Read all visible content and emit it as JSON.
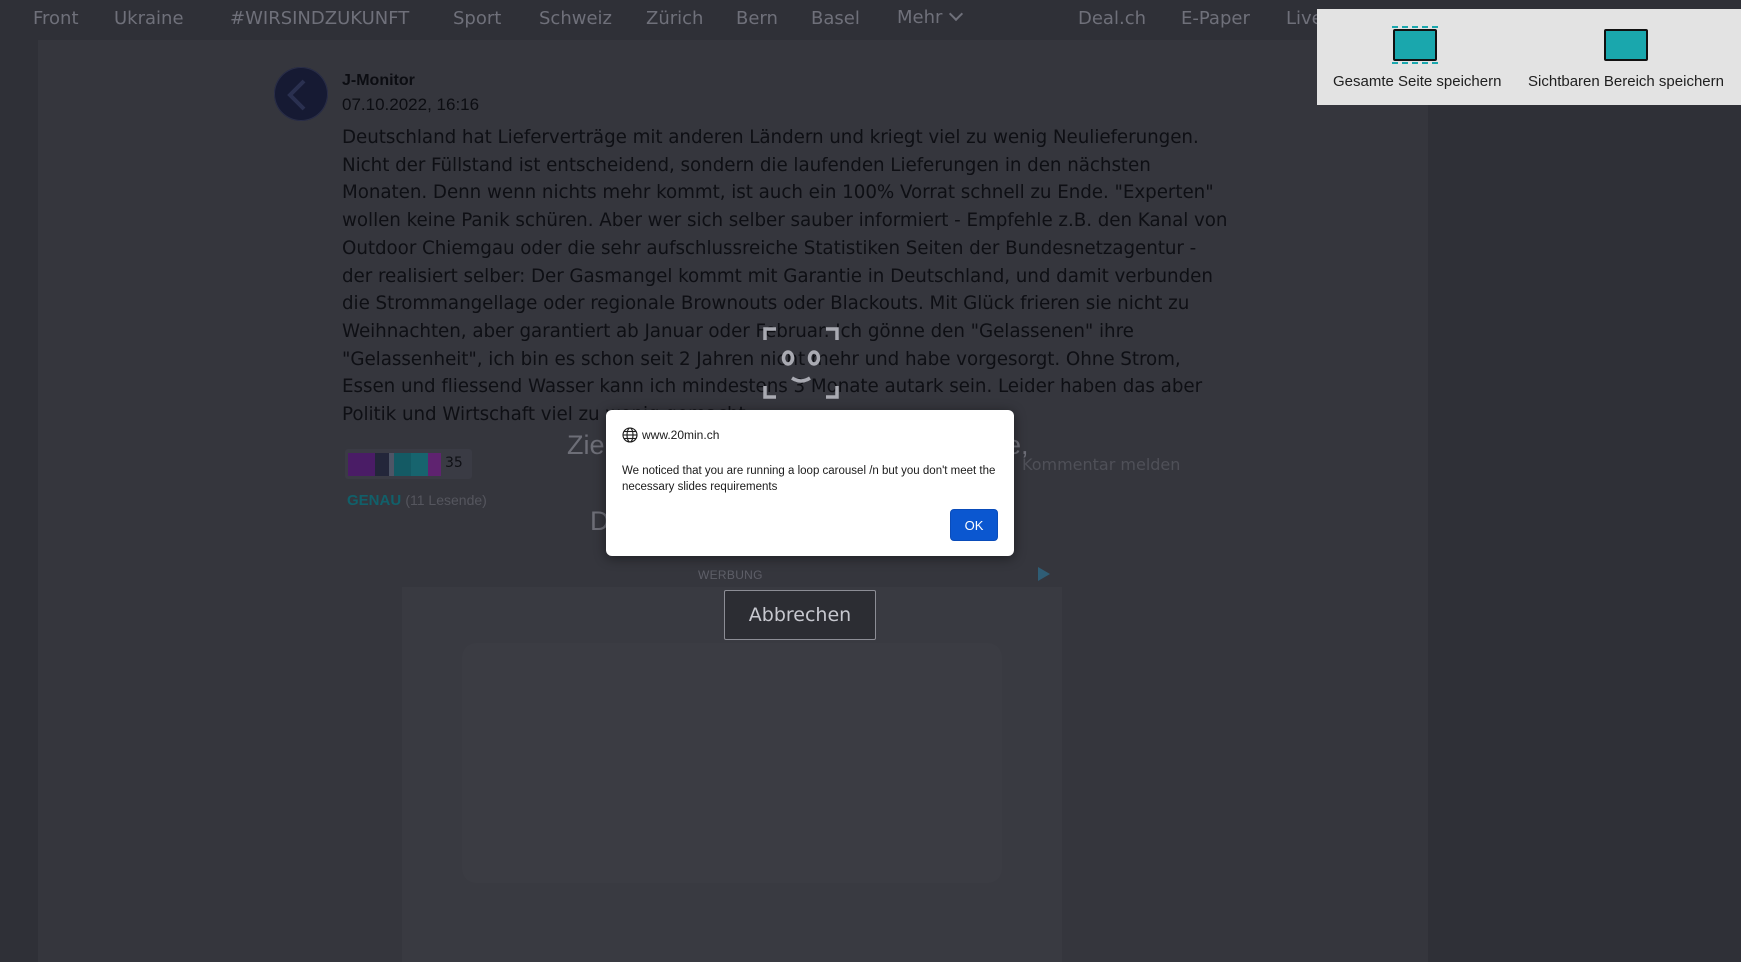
{
  "nav": {
    "items": [
      "Front",
      "Ukraine",
      "#WIRSINDZUKUNFT",
      "Sport",
      "Schweiz",
      "Zürich",
      "Bern",
      "Basel",
      "Mehr",
      "Deal.ch",
      "E-Paper",
      "Live"
    ]
  },
  "comment": {
    "author": "J-Monitor",
    "date": "07.10.2022, 16:16",
    "lines": [
      "Deutschland hat Lieferverträge mit anderen Ländern und kriegt viel zu wenig Neulieferungen.",
      "Nicht der Füllstand ist entscheidend, sondern die laufenden Lieferungen in den nächsten",
      "Monaten. Denn wenn nichts mehr kommt, ist auch ein 100% Vorrat schnell zu Ende. \"Experten\"",
      "wollen keine Panik schüren. Aber wer sich selber sauber informiert - Empfehle z.B. den Kanal von",
      "Outdoor Chiemgau oder die sehr aufschlussreiche Statistiken Seiten der Bundesnetzagentur -",
      "der realisiert selber: Der Gasmangel kommt mit Garantie in Deutschland, und damit verbunden",
      "die Strommangellage oder regionale Brownouts oder Blackouts. Mit Glück frieren sie nicht zu",
      "Weihnachten, aber garantiert ab Januar oder Februar. Ich gönne den \"Gelassenen\" ihre",
      "\"Gelassenheit\", ich bin es schon seit 2 Jahren nicht mehr und habe vorgesorgt. Ohne Strom,",
      "Essen und fliessend Wasser kann ich mindestens 3 Monate autark sein. Leider haben das aber",
      "Politik und Wirtschaft viel zu wenig gemacht."
    ],
    "reaction_count": "35",
    "top_reaction": "GENAU",
    "readers": "(11 Lesende)",
    "report_label": "Kommentar melden",
    "reaction_colors": [
      "#5a1f78",
      "#2b2e45",
      "#5a6275",
      "#1a6d79",
      "#1a7a86",
      "#7a2a8c"
    ]
  },
  "overlay": {
    "faded_line1": "Zie",
    "faded_line1_end": "e,",
    "faded_line2": "D",
    "cancel_label": "Abbrechen"
  },
  "ad": {
    "label": "WERBUNG"
  },
  "dialog": {
    "origin": "www.20min.ch",
    "message": "We noticed that you are running a loop carousel /n but you don't meet the necessary slides requirements",
    "ok_label": "OK"
  },
  "screenshot_tool": {
    "full_page_label": "Gesamte Seite speichern",
    "visible_area_label": "Sichtbaren Bereich speichern",
    "accent": "#1aa7ad"
  }
}
